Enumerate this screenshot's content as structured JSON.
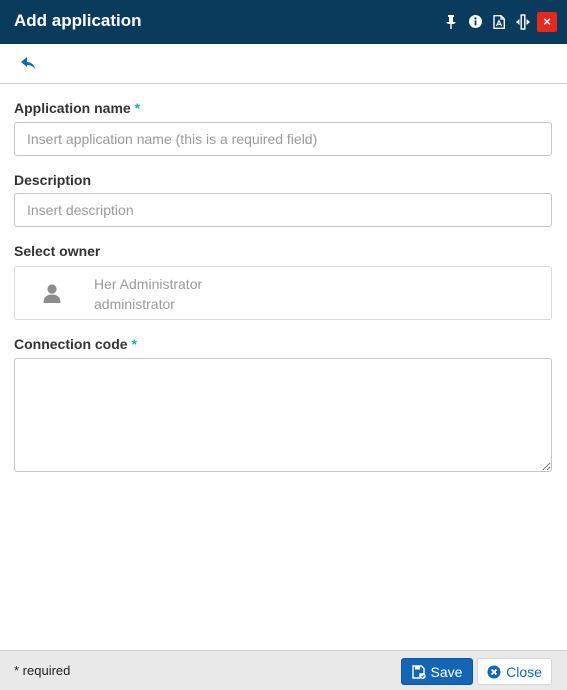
{
  "dialog": {
    "title": "Add application",
    "title_icons": [
      "pin-icon",
      "info-icon",
      "pdf-icon",
      "resize-icon"
    ],
    "close_symbol": "×",
    "colors": {
      "titlebar": "#0b3b5c",
      "close_button": "#e5291f",
      "primary": "#1565b5",
      "required_marker": "#2aa6a6",
      "footer": "#e9e9e9"
    }
  },
  "toolbar": {
    "back_icon": "back-arrow-icon"
  },
  "form": {
    "application_name": {
      "label": "Application name",
      "required_mark": "*",
      "value": "",
      "placeholder": "Insert application name (this is a required field)"
    },
    "description": {
      "label": "Description",
      "value": "",
      "placeholder": "Insert description"
    },
    "owner": {
      "label": "Select owner",
      "avatar_icon": "user-icon",
      "name": "Her Administrator",
      "login": "administrator"
    },
    "connection_code": {
      "label": "Connection code",
      "required_mark": "*",
      "value": ""
    }
  },
  "footer": {
    "note": "* required",
    "save_label": "Save",
    "save_icon": "save-icon",
    "close_label": "Close",
    "close_icon": "close-circle-icon"
  }
}
